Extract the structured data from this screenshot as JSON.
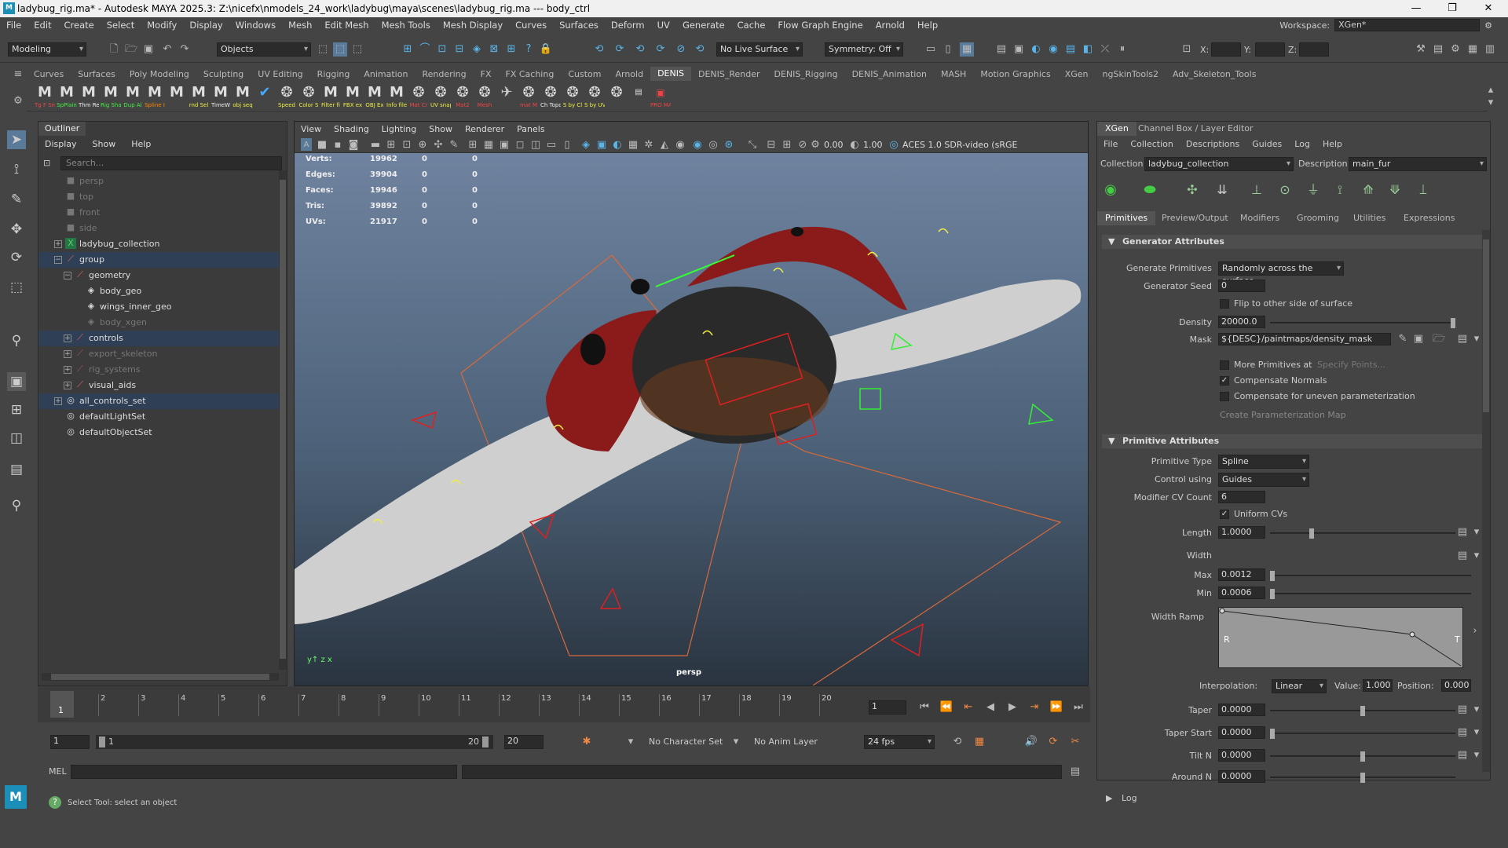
{
  "window": {
    "title": "ladybug_rig.ma* - Autodesk MAYA 2025.3: Z:\\nicefx\\nmodels_24_work\\ladybug\\maya\\scenes\\ladybug_rig.ma   ---   body_ctrl",
    "logo": "M"
  },
  "menu": [
    "File",
    "Edit",
    "Create",
    "Select",
    "Modify",
    "Display",
    "Windows",
    "Mesh",
    "Edit Mesh",
    "Mesh Tools",
    "Mesh Display",
    "Curves",
    "Surfaces",
    "Deform",
    "UV",
    "Generate",
    "Cache",
    "Flow Graph Engine",
    "Arnold",
    "Help"
  ],
  "workspace": {
    "label": "Workspace:",
    "value": "XGen*"
  },
  "statusline": {
    "mode": "Modeling",
    "select_mode": "Objects",
    "live_surface": "No Live Surface",
    "symmetry": "Symmetry: Off",
    "x": "X:",
    "y": "Y:",
    "z": "Z:"
  },
  "shelf_tabs": [
    "Curves",
    "Surfaces",
    "Poly Modeling",
    "Sculpting",
    "UV Editing",
    "Rigging",
    "Animation",
    "Rendering",
    "FX",
    "FX Caching",
    "Custom",
    "Arnold",
    "DENIS",
    "DENIS_Render",
    "DENIS_Rigging",
    "DENIS_Animation",
    "MASH",
    "Motion Graphics",
    "XGen",
    "ngSkinTools2",
    "Adv_Skeleton_Tools"
  ],
  "shelf_active": "DENIS",
  "shelf_items": [
    "Tg F Sm",
    "SpPlain",
    "Thm Re",
    "Rig Sha",
    "Dup Al",
    "Spline I",
    "",
    "rnd Sel",
    "TimeW",
    "obj seq",
    "",
    "Speed",
    "Color S",
    "Filter fi",
    "FBX ex",
    "OBJ Ex",
    "Info file",
    "Mat Cr",
    "UV snap",
    "Mat2",
    "Mesh",
    "",
    "mat M",
    "Ch Topo",
    "S by Cl",
    "S by UV",
    "",
    "",
    "PRO MAT"
  ],
  "outliner": {
    "tab": "Outliner",
    "menu": [
      "Display",
      "Show",
      "Help"
    ],
    "search_placeholder": "Search...",
    "rows": [
      {
        "name": "persp",
        "dim": true
      },
      {
        "name": "top",
        "dim": true
      },
      {
        "name": "front",
        "dim": true
      },
      {
        "name": "side",
        "dim": true
      },
      {
        "name": "ladybug_collection",
        "dim": false
      },
      {
        "name": "group",
        "dim": false
      },
      {
        "name": "geometry",
        "dim": false
      },
      {
        "name": "body_geo",
        "dim": false
      },
      {
        "name": "wings_inner_geo",
        "dim": false
      },
      {
        "name": "body_xgen",
        "dim": true
      },
      {
        "name": "controls",
        "dim": false
      },
      {
        "name": "export_skeleton",
        "dim": true
      },
      {
        "name": "rig_systems",
        "dim": true
      },
      {
        "name": "visual_aids",
        "dim": false
      },
      {
        "name": "all_controls_set",
        "dim": false
      },
      {
        "name": "defaultLightSet",
        "dim": false
      },
      {
        "name": "defaultObjectSet",
        "dim": false
      }
    ]
  },
  "viewport": {
    "menu": [
      "View",
      "Shading",
      "Lighting",
      "Show",
      "Renderer",
      "Panels"
    ],
    "near": "0.00",
    "far": "1.00",
    "colorspace": "ACES 1.0 SDR-video (sRGE",
    "camera": "persp",
    "hud": [
      {
        "label": "Verts:",
        "a": "19962",
        "b": "0",
        "c": "0"
      },
      {
        "label": "Edges:",
        "a": "39904",
        "b": "0",
        "c": "0"
      },
      {
        "label": "Faces:",
        "a": "19946",
        "b": "0",
        "c": "0"
      },
      {
        "label": "Tris:",
        "a": "39892",
        "b": "0",
        "c": "0"
      },
      {
        "label": "UVs:",
        "a": "21917",
        "b": "0",
        "c": "0"
      }
    ]
  },
  "xgen": {
    "tabs": [
      "XGen",
      "Channel Box / Layer Editor"
    ],
    "menu": [
      "File",
      "Collection",
      "Descriptions",
      "Guides",
      "Log",
      "Help"
    ],
    "collection_label": "Collection",
    "collection": "ladybug_collection",
    "description_label": "Description",
    "description": "main_fur",
    "subtabs": [
      "Primitives",
      "Preview/Output",
      "Modifiers",
      "Grooming",
      "Utilities",
      "Expressions"
    ],
    "generator": {
      "title": "Generator Attributes",
      "generate_label": "Generate Primitives",
      "generate": "Randomly across the surface",
      "seed_label": "Generator Seed",
      "seed": "0",
      "flip": "Flip to other side of surface",
      "density_label": "Density",
      "density": "20000.0",
      "mask_label": "Mask",
      "mask": "${DESC}/paintmaps/density_mask",
      "more_prims": "More Primitives at",
      "specify": "Specify Points...",
      "comp_normals": "Compensate Normals",
      "comp_uneven": "Compensate for uneven parameterization",
      "create_map": "Create Parameterization Map"
    },
    "primitive": {
      "title": "Primitive Attributes",
      "type_label": "Primitive Type",
      "type": "Spline",
      "control_label": "Control using",
      "control": "Guides",
      "cv_label": "Modifier CV Count",
      "cv": "6",
      "uniform": "Uniform CVs",
      "length_label": "Length",
      "length": "1.0000",
      "width_label": "Width",
      "max_label": "Max",
      "max": "0.0012",
      "min_label": "Min",
      "min": "0.0006",
      "ramp_label": "Width Ramp",
      "ramp_r": "R",
      "ramp_t": "T",
      "interp_label": "Interpolation:",
      "interp": "Linear",
      "value_label": "Value:",
      "value": "1.000",
      "position_label": "Position:",
      "position": "0.000",
      "taper_label": "Taper",
      "taper": "0.0000",
      "taper_start_label": "Taper Start",
      "taper_start": "0.0000",
      "tilt_label": "Tilt N",
      "tilt": "0.0000",
      "around_label": "Around N",
      "around": "0.0000"
    },
    "log": "Log"
  },
  "timeline": {
    "ticks": [
      "1",
      "2",
      "3",
      "4",
      "5",
      "6",
      "7",
      "8",
      "9",
      "10",
      "11",
      "12",
      "13",
      "14",
      "15",
      "16",
      "17",
      "18",
      "19",
      "20"
    ],
    "current": "1",
    "current_field": "1"
  },
  "range": {
    "start": "1",
    "inner_start": "1",
    "inner_end": "20",
    "end": "20",
    "char_set": "No Character Set",
    "anim_layer": "No Anim Layer",
    "fps": "24 fps"
  },
  "cmd": {
    "label": "MEL"
  },
  "help": {
    "text": "Select Tool: select an object"
  }
}
